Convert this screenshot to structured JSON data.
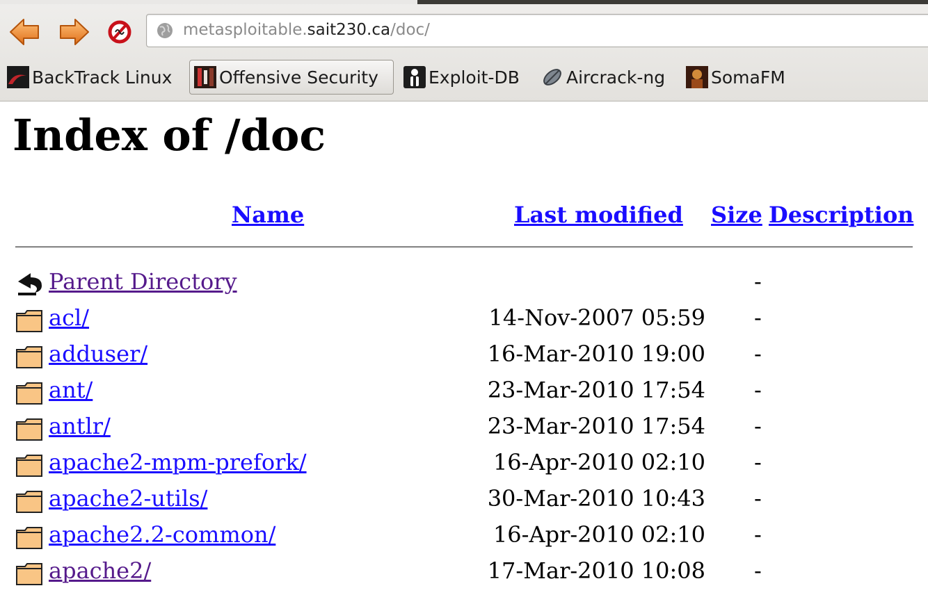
{
  "browser": {
    "url_prefix": "metasploitable.",
    "url_host": "sait230.ca",
    "url_path": "/doc/",
    "bookmarks": [
      {
        "label": "BackTrack Linux"
      },
      {
        "label": "Offensive Security"
      },
      {
        "label": "Exploit-DB"
      },
      {
        "label": "Aircrack-ng"
      },
      {
        "label": "SomaFM"
      }
    ]
  },
  "page": {
    "title": "Index of /doc",
    "columns": {
      "name": "Name",
      "last_modified": "Last modified",
      "size": "Size",
      "description": "Description"
    },
    "parent": {
      "name": "Parent Directory",
      "size": "-"
    },
    "rows": [
      {
        "name": "acl/",
        "modified": "14-Nov-2007 05:59",
        "size": "-"
      },
      {
        "name": "adduser/",
        "modified": "16-Mar-2010 19:00",
        "size": "-"
      },
      {
        "name": "ant/",
        "modified": "23-Mar-2010 17:54",
        "size": "-"
      },
      {
        "name": "antlr/",
        "modified": "23-Mar-2010 17:54",
        "size": "-"
      },
      {
        "name": "apache2-mpm-prefork/",
        "modified": "16-Apr-2010 02:10",
        "size": "-"
      },
      {
        "name": "apache2-utils/",
        "modified": "30-Mar-2010 10:43",
        "size": "-"
      },
      {
        "name": "apache2.2-common/",
        "modified": "16-Apr-2010 02:10",
        "size": "-"
      },
      {
        "name": "apache2/",
        "modified": "17-Mar-2010 10:08",
        "size": "-"
      }
    ]
  }
}
